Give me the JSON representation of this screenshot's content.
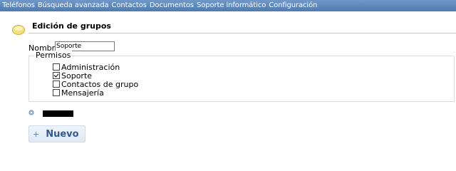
{
  "nav": {
    "items": [
      "Teléfonos",
      "Búsqueda avanzada",
      "Contactos",
      "Documentos",
      "Soporte informático",
      "Configuración"
    ]
  },
  "section": {
    "title": "Edición de grupos"
  },
  "form": {
    "name_label": "Nombre",
    "name_value": "Soporte",
    "permissions_legend": "Permisos",
    "permissions": [
      {
        "label": "Administración",
        "checked": false
      },
      {
        "label": "Soporte",
        "checked": true
      },
      {
        "label": "Contactos de grupo",
        "checked": false
      },
      {
        "label": "Mensajería",
        "checked": false
      }
    ]
  },
  "actions": {
    "new_label": "Nuevo"
  },
  "colors": {
    "nav_bg": "#5a86bc",
    "button_text": "#325a8a"
  }
}
